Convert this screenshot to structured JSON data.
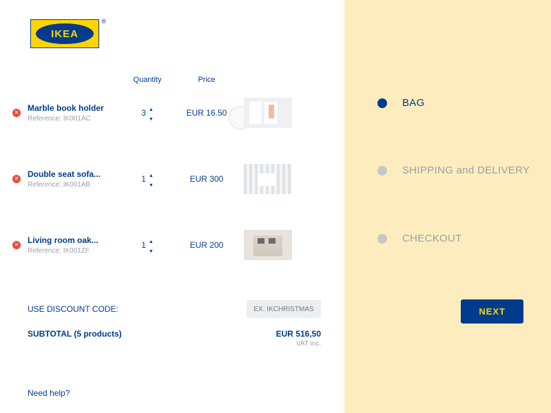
{
  "logo": {
    "text": "IKEA",
    "reg": "®"
  },
  "columns": {
    "qty": "Quantity",
    "price": "Price"
  },
  "items": [
    {
      "name": "Marble book holder",
      "ref": "Reference: IK001AC",
      "qty": "3",
      "price": "EUR 16.50"
    },
    {
      "name": "Double seat sofa...",
      "ref": "Reference: IK001AB",
      "qty": "1",
      "price": "EUR 300"
    },
    {
      "name": "Living room oak...",
      "ref": "Reference: IK001ZF",
      "qty": "1",
      "price": "EUR 200"
    }
  ],
  "discount": {
    "label": "USE DISCOUNT CODE:",
    "placeholder": "EX. IKCHRISTMAS"
  },
  "subtotal": {
    "label": "SUBTOTAL (5 products)",
    "amount": "EUR 516,50",
    "vat": "VAT inc."
  },
  "help": "Need help?",
  "steps": [
    {
      "label": "BAG",
      "active": true
    },
    {
      "label": "SHIPPING and DELIVERY",
      "active": false
    },
    {
      "label": "CHECKOUT",
      "active": false
    }
  ],
  "next": "NEXT"
}
